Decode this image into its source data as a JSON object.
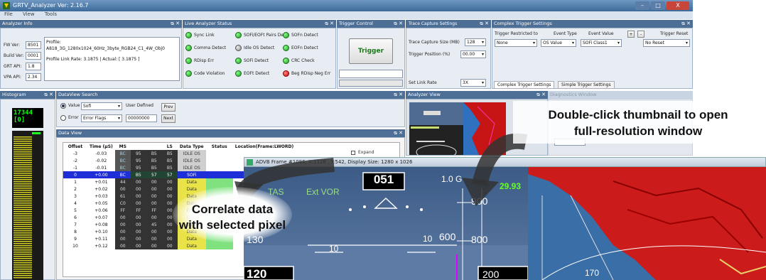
{
  "app": {
    "title": "GRTV_Analyzer Ver: 2.16.7"
  },
  "window_controls": [
    "–",
    "□",
    "X"
  ],
  "menu": [
    "File",
    "View",
    "Tools"
  ],
  "analyzer_info": {
    "header": "Analyzer Info",
    "fw_label": "FW Ver:",
    "fw": "8501",
    "build_label": "Build Ver:",
    "build": "0001",
    "grt_label": "GRT API:",
    "grt": "1.8",
    "vpa_label": "VPA API:",
    "vpa": "2.34",
    "profile_label": "Profile:",
    "profile": "A818_3G_1280x1024_60Hz_3byte_RGB24_C1_4W_Obj0",
    "rate": "Profile Link Rate: 3.1875 | Actual: [ 3.1875 ]"
  },
  "live_status": {
    "header": "Live Analyzer Status",
    "items": [
      {
        "label": "Sync Link",
        "state": "green"
      },
      {
        "label": "SOFi/EOFt Pairs Det",
        "state": "green"
      },
      {
        "label": "SOFn Detect",
        "state": "green"
      },
      {
        "label": "Comma Detect",
        "state": "green"
      },
      {
        "label": "Idle OS Detect",
        "state": "gray"
      },
      {
        "label": "EOFn Detect",
        "state": "green"
      },
      {
        "label": "RDisp Err",
        "state": "green"
      },
      {
        "label": "SOFi Detect",
        "state": "green"
      },
      {
        "label": "CRC Check",
        "state": "green"
      },
      {
        "label": "Code Violation",
        "state": "green"
      },
      {
        "label": "EOFt Detect",
        "state": "green"
      },
      {
        "label": "Beg RDisp Neg Err",
        "state": "red"
      }
    ]
  },
  "trigger_control": {
    "header": "Trigger Control",
    "button": "Trigger"
  },
  "trace": {
    "title": "Trace Capture Settings",
    "size_label": "Trace Capture Size (MB)",
    "size": "128",
    "pos_label": "Trigger Position (%)",
    "pos": "00.00",
    "rate_label": "Set Link Rate",
    "rate": "3X"
  },
  "complex": {
    "header": "Complex Trigger Settings",
    "restricted_label": "Trigger Restricted to",
    "restricted": "None",
    "etype_label": "Event Type",
    "etype": "OS Value",
    "evalue_label": "Event Value",
    "evalue": "SOFi Class1",
    "plus": "+",
    "minus": "-",
    "reset_label": "Trigger Reset",
    "reset": "No Reset",
    "tabs": [
      "Complex Trigger Settings",
      "Simple Trigger Settings"
    ]
  },
  "histogram": {
    "header": "Histogram",
    "value": "17344",
    "sub": "[0]"
  },
  "dataview_search": {
    "header": "DataView Search",
    "value_label": "Value",
    "value_sel": "Sofi",
    "error_label": "Error",
    "error_sel": "Error Flags",
    "user_label": "User Defined",
    "user_val": "00000000",
    "prev": "Prev",
    "next": "Next"
  },
  "analyzer_view": {
    "header": "Analyzer View",
    "diag": "Diagnostics Window",
    "expand": "Expand"
  },
  "data_view": {
    "header": "Data View",
    "columns": [
      "Offset",
      "Time (µS)",
      "MS",
      "",
      "",
      "LS",
      "Data Type",
      "Status",
      "Location(Frame:LWORD)"
    ],
    "rows": [
      [
        "-3",
        "-0.03",
        "BC",
        "95",
        "B5",
        "B5",
        "IDLE OS",
        "",
        ""
      ],
      [
        "-2",
        "-0.02",
        "BC",
        "95",
        "B5",
        "B5",
        "IDLE OS",
        "",
        ""
      ],
      [
        "-1",
        "-0.01",
        "BC",
        "95",
        "B5",
        "B5",
        "IDLE OS",
        "",
        ""
      ],
      [
        "0",
        "+0.00",
        "BC",
        "B5",
        "57",
        "57",
        "SOFi",
        "",
        ""
      ],
      [
        "1",
        "+0.01",
        "44",
        "00",
        "00",
        "00",
        "Data",
        "",
        ""
      ],
      [
        "2",
        "+0.02",
        "00",
        "00",
        "00",
        "00",
        "Data",
        "",
        ""
      ],
      [
        "3",
        "+0.03",
        "61",
        "00",
        "00",
        "00",
        "Data",
        "",
        ""
      ],
      [
        "4",
        "+0.05",
        "C0",
        "00",
        "00",
        "00",
        "Data",
        "",
        ""
      ],
      [
        "5",
        "+0.06",
        "FF",
        "FF",
        "FF",
        "00",
        "Data",
        "",
        ""
      ],
      [
        "6",
        "+0.07",
        "00",
        "00",
        "00",
        "00",
        "Data",
        "",
        ""
      ],
      [
        "7",
        "+0.08",
        "00",
        "00",
        "45",
        "00",
        "Data",
        "",
        ""
      ],
      [
        "8",
        "+0.10",
        "00",
        "00",
        "00",
        "00",
        "Data",
        "",
        ""
      ],
      [
        "9",
        "+0.11",
        "00",
        "00",
        "00",
        "00",
        "Data",
        "",
        ""
      ],
      [
        "10",
        "+0.12",
        "00",
        "00",
        "00",
        "00",
        "Data",
        "",
        ""
      ]
    ]
  },
  "adv_window": {
    "title": "ADVB Frame #1086, X:1128 , Y:542, Display Size: 1280 x 1026",
    "hud": {
      "heading": "051",
      "g": "1.0 G",
      "tas": "TAS",
      "vor": "Ext VOR",
      "right_val": "29.93",
      "alt1": "900",
      "alt2": "800",
      "alt3": "600",
      "spd": "130",
      "spd_big": "120",
      "marks": [
        "10",
        "10"
      ],
      "bottom_r": "200",
      "map_lbl": "170"
    }
  },
  "callouts": {
    "dbl": [
      "Double-click thumbnail to open",
      "full-resolution window"
    ],
    "corr": [
      "Correlate data",
      "with selected pixel"
    ]
  },
  "colors": {
    "panel_header": "#4d6f96",
    "title": "#3c6a99",
    "selected": "#1e2fd8",
    "led_green": "#1a9a1a"
  }
}
